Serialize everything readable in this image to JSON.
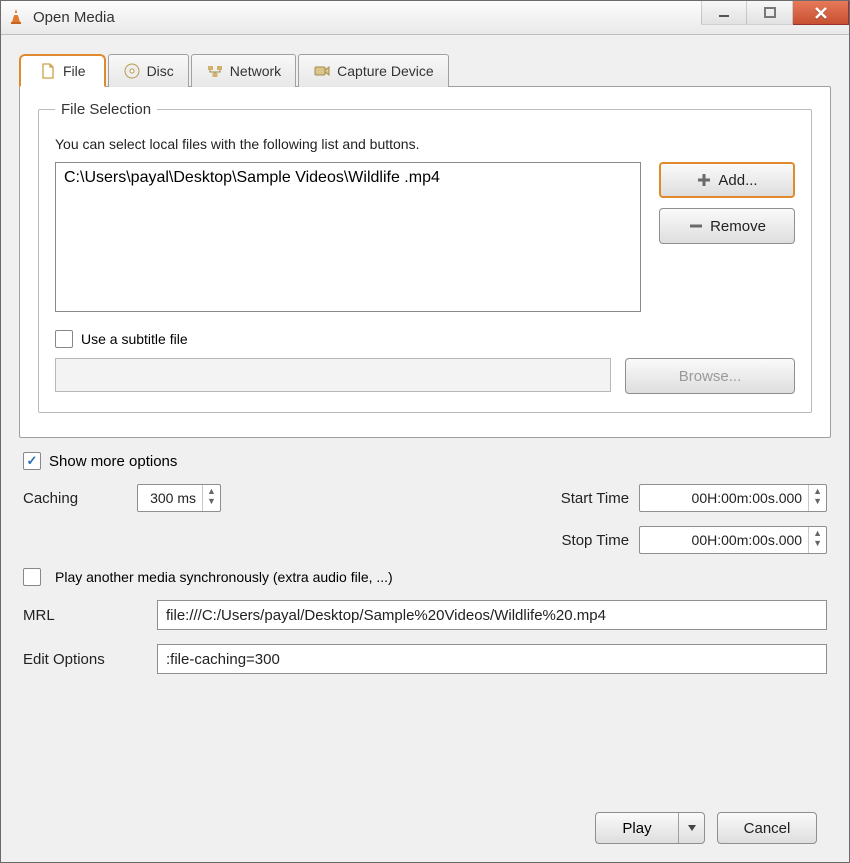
{
  "window": {
    "title": "Open Media"
  },
  "tabs": {
    "file": "File",
    "disc": "Disc",
    "network": "Network",
    "capture": "Capture Device"
  },
  "file_selection": {
    "legend": "File Selection",
    "hint": "You can select local files with the following list and buttons.",
    "items": [
      "C:\\Users\\payal\\Desktop\\Sample Videos\\Wildlife .mp4"
    ],
    "add_label": "Add...",
    "remove_label": "Remove"
  },
  "subtitle": {
    "checkbox_label": "Use a subtitle file",
    "checked": false,
    "browse_label": "Browse..."
  },
  "show_more": {
    "label": "Show more options",
    "checked": true
  },
  "options": {
    "caching_label": "Caching",
    "caching_value": "300 ms",
    "start_label": "Start Time",
    "start_value": "00H:00m:00s.000",
    "stop_label": "Stop Time",
    "stop_value": "00H:00m:00s.000",
    "sync_checkbox_label": "Play another media synchronously (extra audio file, ...)",
    "sync_checked": false,
    "mrl_label": "MRL",
    "mrl_value": "file:///C:/Users/payal/Desktop/Sample%20Videos/Wildlife%20.mp4",
    "edit_label": "Edit Options",
    "edit_value": ":file-caching=300"
  },
  "footer": {
    "play_label": "Play",
    "cancel_label": "Cancel"
  }
}
